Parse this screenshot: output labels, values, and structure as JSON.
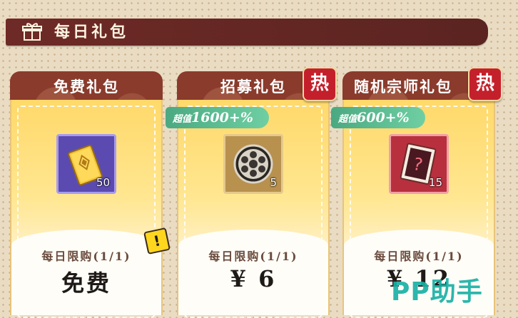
{
  "header": {
    "title": "每日礼包"
  },
  "cards": [
    {
      "title": "免费礼包",
      "item_count": "50",
      "limit": "每日限购(1/1)",
      "price": "免费"
    },
    {
      "title": "招募礼包",
      "hot_label": "热",
      "value_small": "超值",
      "value_big": "1600+%",
      "item_count": "5",
      "limit": "每日限购(1/1)",
      "price": "¥ 6"
    },
    {
      "title": "随机宗师礼包",
      "hot_label": "热",
      "value_small": "超值",
      "value_big": "600+%",
      "item_count": "15",
      "limit": "每日限购(1/1)",
      "price": "¥ 12"
    }
  ],
  "watermark": "PP助手",
  "colors": {
    "header_bg": "#5b2421",
    "tab_bg": "#8a3b2c",
    "hot_bg": "#c4202c",
    "value_tag": "#4aa981"
  }
}
